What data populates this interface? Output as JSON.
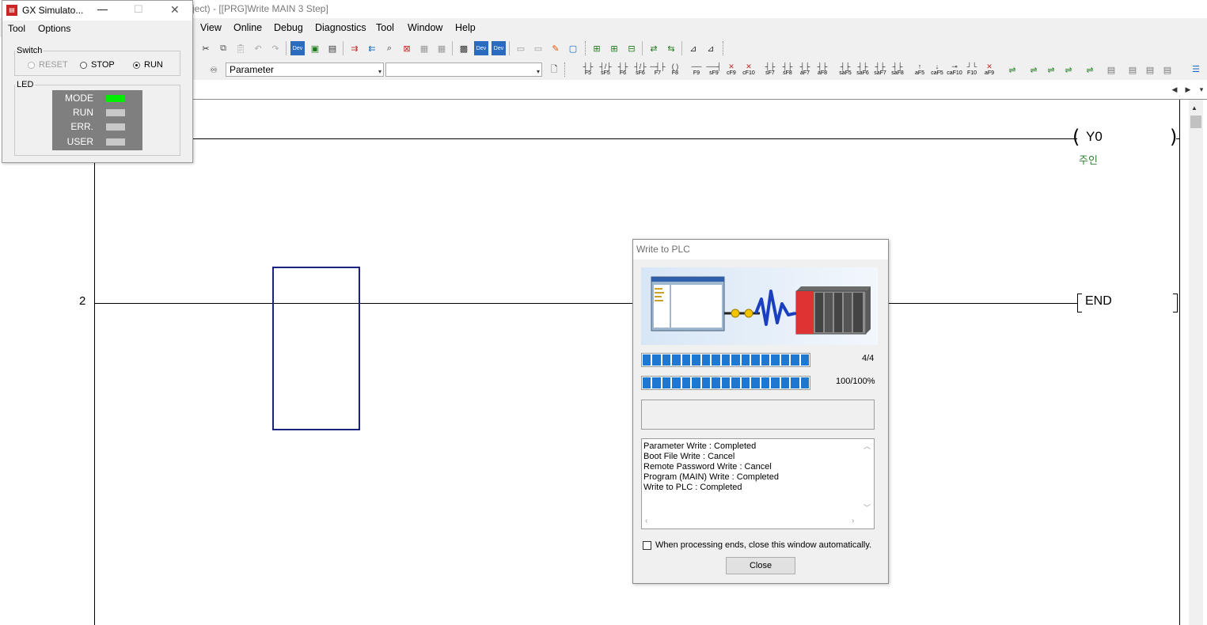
{
  "main_window": {
    "title": "ject) - [[PRG]Write MAIN 3 Step]"
  },
  "menubar": {
    "items": [
      "View",
      "Online",
      "Debug",
      "Diagnostics",
      "Tool",
      "Window",
      "Help"
    ]
  },
  "toolbar": {
    "parameter_combo": "Parameter",
    "fkeys": [
      "F5",
      "sF5",
      "F6",
      "sF6",
      "F7",
      "F8",
      "F9",
      "sF9",
      "cF9",
      "cF10",
      "sF7",
      "sF8",
      "aF7",
      "aF8",
      "saF5",
      "saF6",
      "saF7",
      "saF8",
      "aF5",
      "caF5",
      "caF10",
      "F10",
      "aF9"
    ]
  },
  "ladder": {
    "coil_label": "Y0",
    "coil_comment": "주인",
    "step_number": "2",
    "end_label": "END",
    "left_fragment": "⊙⊙ ·"
  },
  "simulator": {
    "title": "GX Simulato...",
    "menu": [
      "Tool",
      "Options"
    ],
    "switch_group": "Switch",
    "switch_options": [
      {
        "label": "RESET",
        "selected": false,
        "enabled": false
      },
      {
        "label": "STOP",
        "selected": false,
        "enabled": true
      },
      {
        "label": "RUN",
        "selected": true,
        "enabled": true
      }
    ],
    "led_group": "LED",
    "leds": [
      {
        "label": "MODE",
        "on": true,
        "color": "#00ee00"
      },
      {
        "label": "RUN",
        "on": false,
        "color": "#c8c8c8"
      },
      {
        "label": "ERR.",
        "on": false,
        "color": "#c8c8c8"
      },
      {
        "label": "USER",
        "on": false,
        "color": "#c8c8c8"
      }
    ]
  },
  "write_dialog": {
    "title": "Write to PLC",
    "progress_count": "4/4",
    "progress_percent": "100/100%",
    "progress_fraction_1": 1.0,
    "progress_fraction_2": 1.0,
    "log_lines": [
      "Parameter Write : Completed",
      "Boot File Write : Cancel",
      "Remote Password Write : Cancel",
      "Program (MAIN) Write : Completed",
      "Write to PLC : Completed"
    ],
    "auto_close_label": "When processing ends, close this window automatically.",
    "auto_close_checked": false,
    "close_button": "Close"
  },
  "colors": {
    "progress_blue": "#1e78d2",
    "cursor_box": "#1a237e",
    "comment_green": "#2e7d32"
  }
}
